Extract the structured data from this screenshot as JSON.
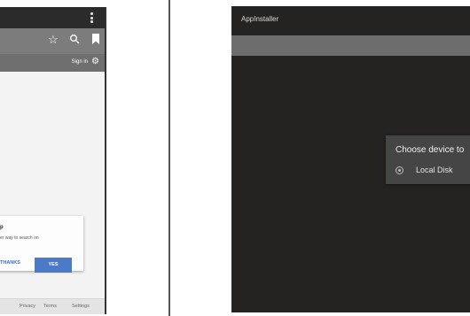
{
  "browser": {
    "sign_in": "Sign in",
    "dialog": {
      "title": "p",
      "text": "er way to search on",
      "no_thanks": "THANKS",
      "yes": "YES"
    },
    "footer": {
      "privacy": "Privacy",
      "terms": "Terms",
      "settings": "Settings"
    },
    "icons": [
      "star-icon",
      "search-icon",
      "bookmark-icon",
      "gear-icon",
      "menu-dots-icon"
    ],
    "colors": {
      "accent": "#4b7bc8",
      "toolbar": "#7c7c7c"
    }
  },
  "installer": {
    "app_title": "AppInstaller",
    "dialog": {
      "heading": "Choose device to",
      "option": "Local Disk"
    },
    "colors": {
      "background": "#252222",
      "actionbar": "#6d6d6d",
      "dialog": "#454545"
    }
  }
}
